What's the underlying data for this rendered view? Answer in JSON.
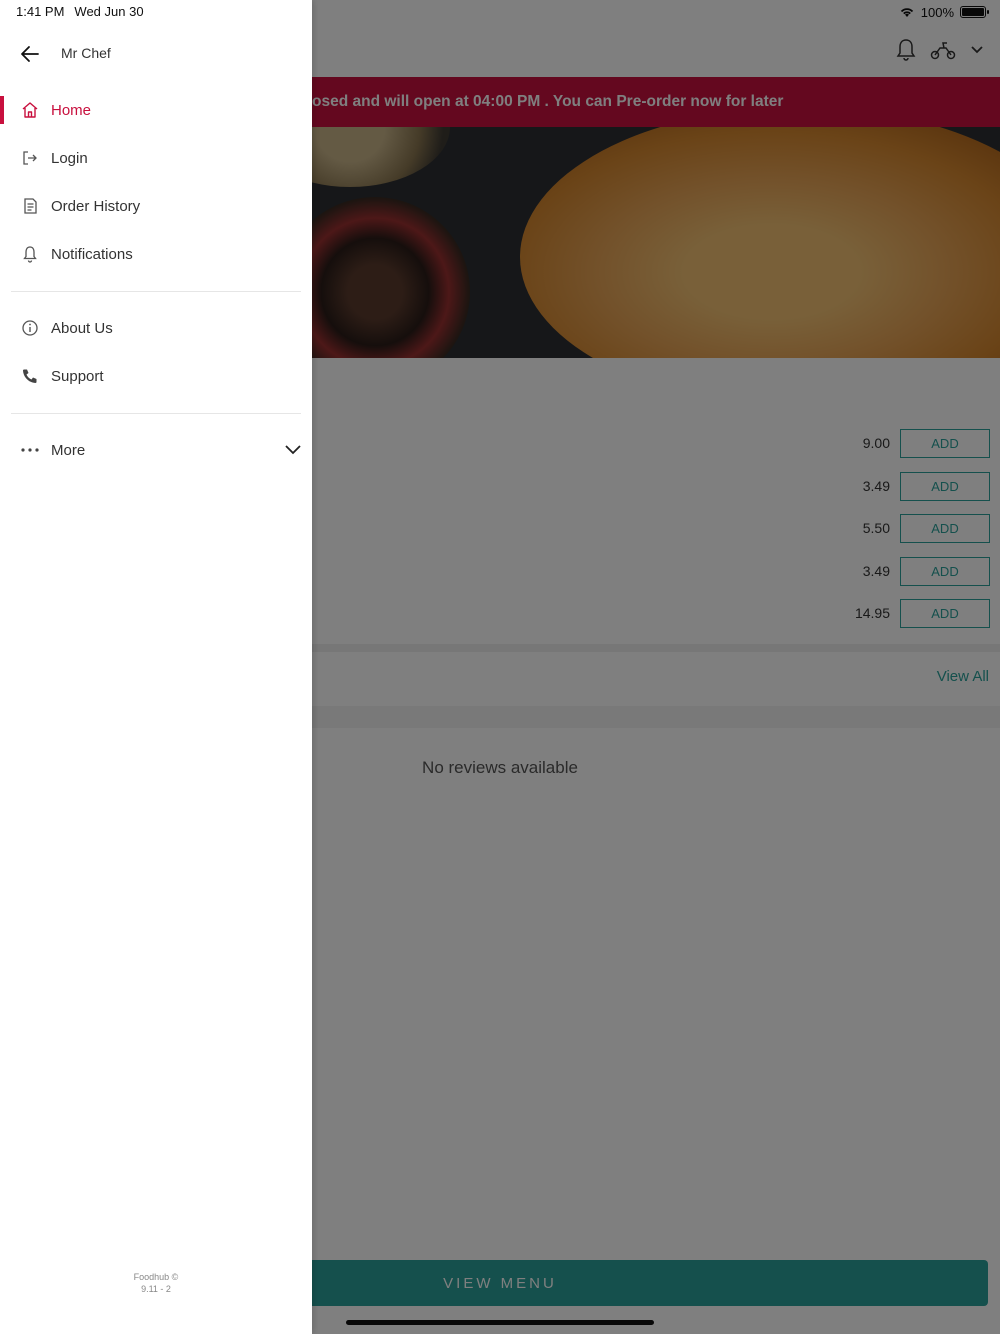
{
  "status": {
    "time": "1:41 PM",
    "date": "Wed Jun 30",
    "battery": "100%"
  },
  "drawer": {
    "title": "Mr Chef",
    "items": [
      {
        "label": "Home",
        "icon": "home-icon",
        "active": true
      },
      {
        "label": "Login",
        "icon": "login-icon"
      },
      {
        "label": "Order History",
        "icon": "receipt-icon"
      },
      {
        "label": "Notifications",
        "icon": "bell-icon"
      },
      {
        "label": "About Us",
        "icon": "info-icon"
      },
      {
        "label": "Support",
        "icon": "phone-icon"
      },
      {
        "label": "More",
        "icon": "more-dots-icon"
      }
    ],
    "footer_brand": "Foodhub ©",
    "footer_version": "9.11 - 2"
  },
  "banner": {
    "text": "osed and will open at 04:00 PM . You can Pre-order now for later"
  },
  "menu": {
    "add_label": "ADD",
    "prices": [
      "9.00",
      "3.49",
      "5.50",
      "3.49",
      "14.95"
    ]
  },
  "reviews": {
    "view_all": "View All",
    "empty": "No reviews available"
  },
  "cta": {
    "view_menu": "VIEW MENU"
  },
  "colors": {
    "brand": "#c8103e",
    "accent": "#2aa19a"
  }
}
